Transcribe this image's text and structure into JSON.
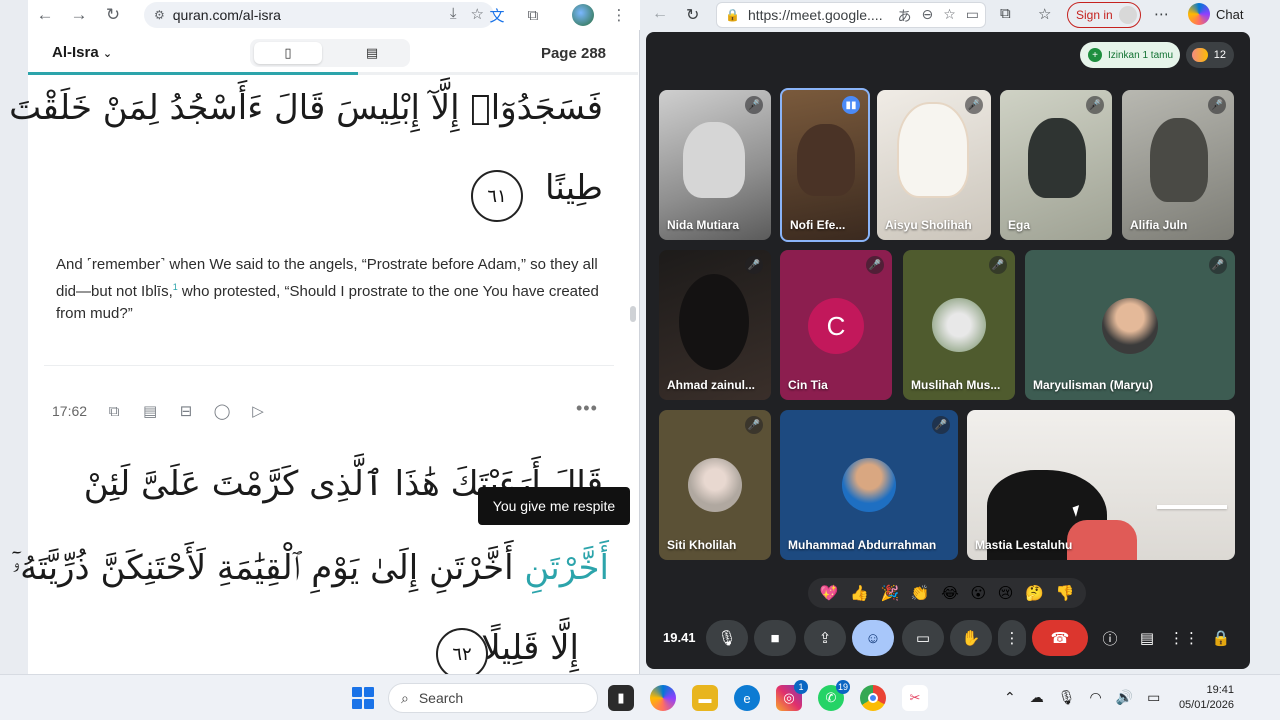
{
  "left_browser": {
    "url": "quran.com/al-isra",
    "header": {
      "surah": "Al-Isra",
      "page": "Page 288"
    },
    "arabic_lines": [
      "فَسَجَدُوٓا۟ إِلَّآ إِبْلِيسَ قَالَ ءَأَسْجُدُ لِمَنْ خَلَقْتَ",
      "طِينًا",
      "قَالَ أَرَءَيْتَكَ هَٰذَا ٱلَّذِى كَرَّمْتَ عَلَىَّ لَئِنْ",
      "أَخَّرْتَنِ إِلَىٰ يَوْمِ ٱلْقِيَٰمَةِ لَأَحْتَنِكَنَّ ذُرِّيَّتَهُۥٓ",
      "إِلَّا قَلِيلًا"
    ],
    "highlight_word": "أَخَّرْتَنِ",
    "verse_markers": [
      "٦١",
      "٦٢"
    ],
    "translation_parts": {
      "before": "And ˹remember˺ when We said to the angels, “Prostrate before Adam,” so they all did—but not Iblīs,",
      "footnote": "1",
      "after": " who protested, “Should I prostrate to the one You have created from mud?”"
    },
    "verse_ref": "17:62",
    "tooltip": "You give me respite"
  },
  "right_browser": {
    "url": "https://meet.google....",
    "sign_in": "Sign in",
    "chat": "Chat",
    "admit_label": "Izinkan 1 tamu",
    "participant_count": "12",
    "time": "19.41",
    "participants": [
      {
        "name": "Nida Mutiara"
      },
      {
        "name": "Nofi Efe..."
      },
      {
        "name": "Aisyu Sholihah"
      },
      {
        "name": "Ega"
      },
      {
        "name": "Alifia Juln"
      },
      {
        "name": "Ahmad zainul..."
      },
      {
        "name": "Cin Tia",
        "initial": "C"
      },
      {
        "name": "Muslihah Mus..."
      },
      {
        "name": "Maryulisman (Maryu)"
      },
      {
        "name": "Siti Kholilah"
      },
      {
        "name": "Muhammad Abdurrahman"
      },
      {
        "name": "Mastia Lestaluhu"
      }
    ],
    "reactions": [
      "💖",
      "👍",
      "🎉",
      "👏",
      "😂",
      "😮",
      "😢",
      "🤔",
      "👎"
    ]
  },
  "taskbar": {
    "search": "Search",
    "instagram_badge": "1",
    "whatsapp_badge": "19",
    "clock_time": "19:41",
    "clock_date": "05/01/2026"
  }
}
